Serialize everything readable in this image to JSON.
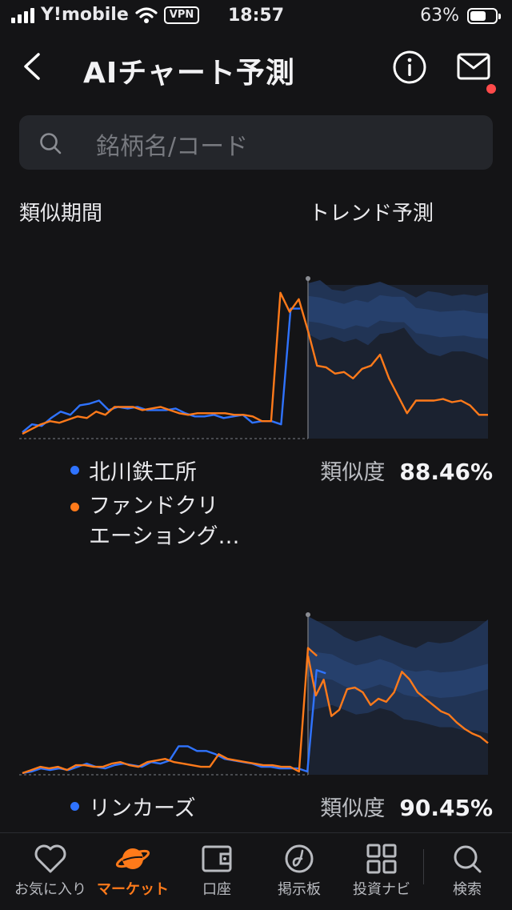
{
  "status_bar": {
    "carrier": "Y!mobile",
    "vpn": "VPN",
    "time": "18:57",
    "battery": "63%",
    "battery_level": 0.63
  },
  "header": {
    "title": "AIチャート予測"
  },
  "search": {
    "placeholder": "銘柄名/コード"
  },
  "columns": {
    "similar_period": "類似期間",
    "trend_forecast": "トレンド予測"
  },
  "colors": {
    "blue_series": "#2f73ff",
    "orange_series": "#ff7a1a",
    "forecast_band": "#22365a",
    "accent": "#ff7a1a"
  },
  "results": [
    {
      "stock": "北川鉄工所",
      "compared": "ファンドクリエーショング…",
      "compared_line1": "ファンドクリ",
      "compared_line2": "エーショング…",
      "similarity_label": "類似度",
      "similarity": "88.46%",
      "blue_series": [
        4,
        9,
        8,
        13,
        17,
        15,
        21,
        22,
        24,
        18,
        20,
        19,
        20,
        18,
        18,
        18,
        19,
        16,
        14,
        14,
        15,
        13,
        14,
        15,
        10,
        11,
        11,
        9,
        82,
        82
      ],
      "orange_series": [
        3,
        6,
        9,
        11,
        10,
        12,
        14,
        13,
        17,
        15,
        20,
        20,
        20,
        18,
        19,
        20,
        18,
        16,
        15,
        16,
        16,
        16,
        16,
        15,
        15,
        14,
        11,
        11,
        92,
        80,
        88,
        68
      ],
      "forecast_series": [
        68,
        46,
        45,
        41,
        42,
        38,
        44,
        46,
        53,
        38,
        27,
        16,
        24,
        24,
        24,
        25,
        23,
        24,
        21,
        15,
        15
      ],
      "forecast_band": {
        "upper": [
          98,
          100,
          94,
          93,
          96,
          97,
          99,
          96,
          93,
          89,
          93,
          92,
          90,
          91,
          90,
          92
        ],
        "lower": [
          66,
          62,
          64,
          61,
          63,
          59,
          66,
          67,
          70,
          60,
          54,
          52,
          55,
          55,
          53,
          50
        ]
      }
    },
    {
      "stock": "リンカーズ",
      "similarity_label": "類似度",
      "similarity": "90.45%",
      "blue_series": [
        1,
        2,
        4,
        3,
        4,
        3,
        5,
        7,
        5,
        4,
        6,
        7,
        6,
        5,
        8,
        7,
        9,
        18,
        18,
        15,
        15,
        13,
        10,
        9,
        8,
        7,
        5,
        5,
        4,
        4,
        4,
        2,
        66,
        64
      ],
      "orange_series": [
        1,
        3,
        5,
        4,
        5,
        3,
        6,
        6,
        5,
        5,
        7,
        8,
        6,
        5,
        8,
        9,
        10,
        8,
        7,
        6,
        5,
        5,
        13,
        10,
        9,
        8,
        7,
        6,
        6,
        5,
        5,
        2,
        80,
        75,
        50,
        60,
        37,
        41,
        54,
        55,
        52,
        44,
        48,
        46,
        52,
        65,
        60,
        52,
        48,
        44,
        40,
        38,
        33,
        29,
        26,
        24,
        20
      ],
      "forecast_band": {
        "upper": [
          100,
          96,
          92,
          87,
          84,
          86,
          88,
          85,
          82,
          80,
          84,
          83,
          84,
          88,
          92,
          98
        ],
        "lower": [
          40,
          42,
          44,
          41,
          38,
          39,
          42,
          40,
          35,
          34,
          32,
          30,
          30,
          28,
          28,
          26
        ]
      }
    }
  ],
  "tabs": [
    {
      "label": "お気に入り",
      "icon": "heart-icon"
    },
    {
      "label": "マーケット",
      "icon": "planet-icon",
      "active": true
    },
    {
      "label": "口座",
      "icon": "wallet-icon"
    },
    {
      "label": "掲示板",
      "icon": "board-icon"
    },
    {
      "label": "投資ナビ",
      "icon": "grid-icon"
    },
    {
      "label": "検索",
      "icon": "search-icon"
    }
  ]
}
